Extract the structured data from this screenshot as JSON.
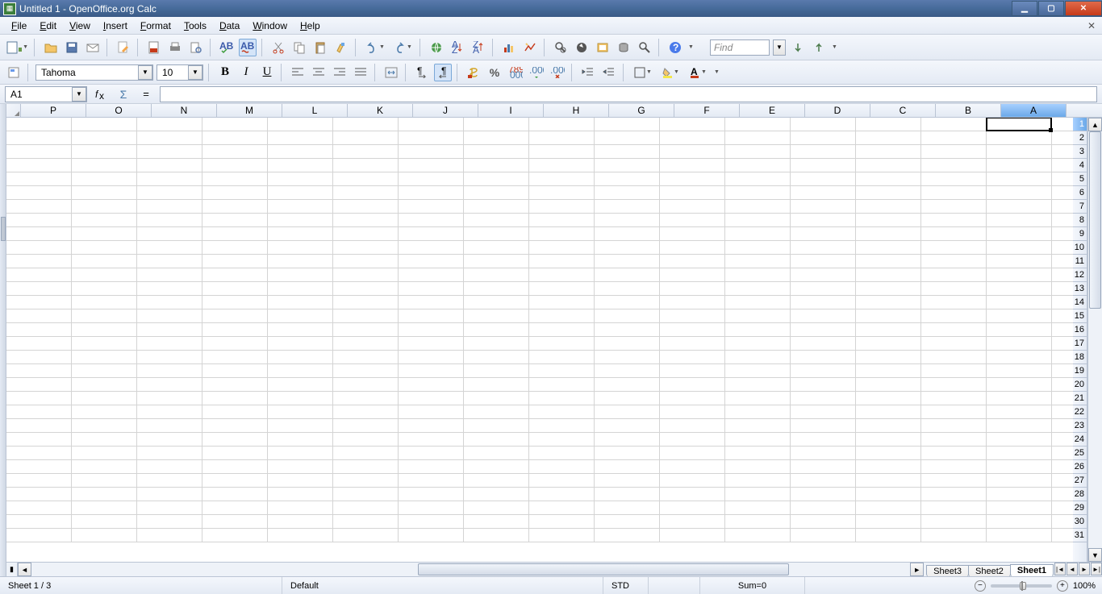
{
  "title": "Untitled 1 - OpenOffice.org Calc",
  "menu": [
    "File",
    "Edit",
    "View",
    "Insert",
    "Format",
    "Tools",
    "Data",
    "Window",
    "Help"
  ],
  "find_placeholder": "Find",
  "font": {
    "name": "Tahoma",
    "size": "10"
  },
  "name_box": "A1",
  "formula": "",
  "columns": [
    "P",
    "O",
    "N",
    "M",
    "L",
    "K",
    "J",
    "I",
    "H",
    "G",
    "F",
    "E",
    "D",
    "C",
    "B",
    "A"
  ],
  "selected_col": "A",
  "rows_visible": 31,
  "selected_row": 1,
  "sheet_tabs": [
    "Sheet3",
    "Sheet2",
    "Sheet1"
  ],
  "active_sheet": "Sheet1",
  "status": {
    "sheet": "Sheet 1 / 3",
    "style": "Default",
    "mode": "STD",
    "sum": "Sum=0",
    "zoom": "100%"
  }
}
